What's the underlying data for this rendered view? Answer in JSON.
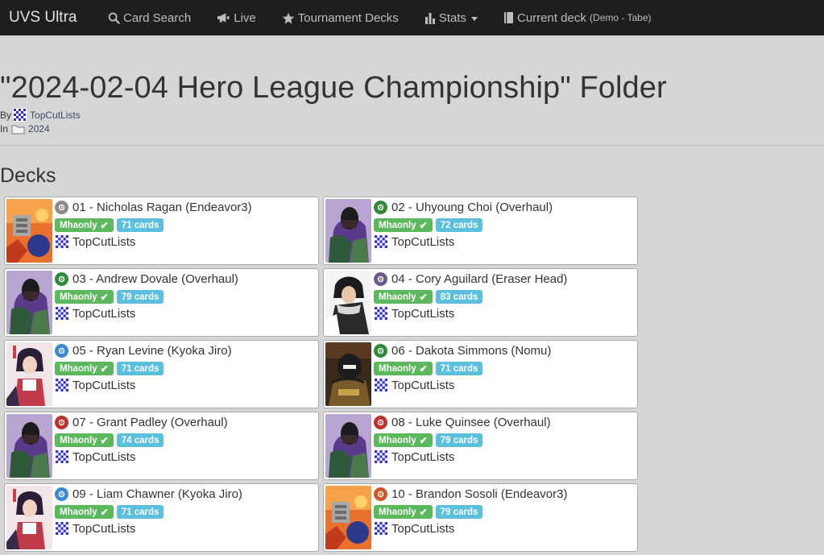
{
  "navbar": {
    "brand": "UVS Ultra",
    "items": [
      {
        "label": "Card Search",
        "icon": "search-icon"
      },
      {
        "label": "Live",
        "icon": "bullhorn-icon"
      },
      {
        "label": "Tournament Decks",
        "icon": "star-icon"
      },
      {
        "label": "Stats",
        "icon": "bar-chart-icon"
      },
      {
        "label": "Current deck",
        "sub": "(Demo - Tabe)",
        "icon": "book-icon"
      }
    ]
  },
  "header": {
    "title": "\"2024-02-04 Hero League Championship\" Folder",
    "by_label": "By",
    "author": "TopCutLists",
    "in_label": "In",
    "folder": "2024"
  },
  "decks_heading": "Decks",
  "decks": [
    {
      "title": "01 - Nicholas Ragan (Endeavor3)",
      "format": "Mhaonly",
      "check": "✔",
      "cards": "71 cards",
      "author": "TopCutLists",
      "symbol": "gray",
      "art": "endeavor"
    },
    {
      "title": "02 - Uhyoung Choi (Overhaul)",
      "format": "Mhaonly",
      "check": "✔",
      "cards": "72 cards",
      "author": "TopCutLists",
      "symbol": "green",
      "art": "overhaul"
    },
    {
      "title": "03 - Andrew Dovale (Overhaul)",
      "format": "Mhaonly",
      "check": "✔",
      "cards": "79 cards",
      "author": "TopCutLists",
      "symbol": "green",
      "art": "overhaul"
    },
    {
      "title": "04 - Cory Aguilard (Eraser Head)",
      "format": "Mhaonly",
      "check": "✔",
      "cards": "83 cards",
      "author": "TopCutLists",
      "symbol": "purple",
      "art": "eraser"
    },
    {
      "title": "05 - Ryan Levine (Kyoka Jiro)",
      "format": "Mhaonly",
      "check": "✔",
      "cards": "71 cards",
      "author": "TopCutLists",
      "symbol": "blue",
      "art": "jiro"
    },
    {
      "title": "06 - Dakota Simmons (Nomu)",
      "format": "Mhaonly",
      "check": "✔",
      "cards": "71 cards",
      "author": "TopCutLists",
      "symbol": "green",
      "art": "nomu"
    },
    {
      "title": "07 - Grant Padley (Overhaul)",
      "format": "Mhaonly",
      "check": "✔",
      "cards": "74 cards",
      "author": "TopCutLists",
      "symbol": "red",
      "art": "overhaul"
    },
    {
      "title": "08 - Luke Quinsee (Overhaul)",
      "format": "Mhaonly",
      "check": "✔",
      "cards": "79 cards",
      "author": "TopCutLists",
      "symbol": "red",
      "art": "overhaul"
    },
    {
      "title": "09 - Liam Chawner (Kyoka Jiro)",
      "format": "Mhaonly",
      "check": "✔",
      "cards": "71 cards",
      "author": "TopCutLists",
      "symbol": "blue",
      "art": "jiro"
    },
    {
      "title": "10 - Brandon Sosoli (Endeavor3)",
      "format": "Mhaonly",
      "check": "✔",
      "cards": "79 cards",
      "author": "TopCutLists",
      "symbol": "orange",
      "art": "endeavor"
    }
  ],
  "colors": {
    "navbar_bg": "#1e1e1e",
    "page_bg": "#d6d6d6",
    "badge_green": "#5cb85c",
    "badge_blue": "#5bc0de"
  }
}
